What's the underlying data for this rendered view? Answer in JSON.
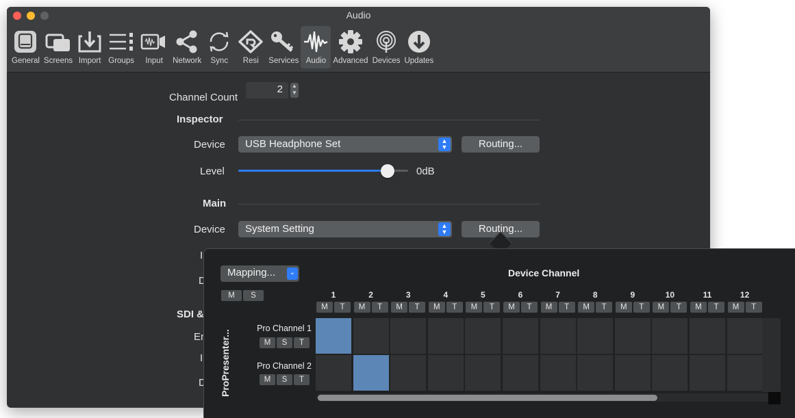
{
  "window": {
    "title": "Audio"
  },
  "toolbar": {
    "items": [
      {
        "label": "General",
        "icon": "general-icon"
      },
      {
        "label": "Screens",
        "icon": "screens-icon"
      },
      {
        "label": "Import",
        "icon": "import-icon"
      },
      {
        "label": "Groups",
        "icon": "groups-icon"
      },
      {
        "label": "Input",
        "icon": "input-icon"
      },
      {
        "label": "Network",
        "icon": "network-icon"
      },
      {
        "label": "Sync",
        "icon": "sync-icon"
      },
      {
        "label": "Resi",
        "icon": "resi-icon"
      },
      {
        "label": "Services",
        "icon": "key-icon"
      },
      {
        "label": "Audio",
        "icon": "waveform-icon",
        "active": true
      },
      {
        "label": "Advanced",
        "icon": "gear-icon"
      },
      {
        "label": "Devices",
        "icon": "devices-icon"
      },
      {
        "label": "Updates",
        "icon": "download-icon"
      }
    ]
  },
  "settings": {
    "channel_count_label": "Channel Count",
    "channel_count_value": "2",
    "inspector": {
      "title": "Inspector",
      "device_label": "Device",
      "device_value": "USB Headphone Set",
      "routing_label": "Routing...",
      "level_label": "Level",
      "level_value": "0dB",
      "level_fraction": 0.88
    },
    "main": {
      "title": "Main",
      "device_label": "Device",
      "device_value": "System Setting",
      "routing_label": "Routing..."
    },
    "hidden_labels": {
      "sdi": "SDI &",
      "en": "En",
      "d1": "D",
      "l1": "I",
      "d2": "D",
      "l2": "I"
    }
  },
  "routing_popover": {
    "mapping_label": "Mapping...",
    "ms_buttons": [
      "M",
      "S"
    ],
    "device_channel_title": "Device Channel",
    "columns": [
      "1",
      "2",
      "3",
      "4",
      "5",
      "6",
      "7",
      "8",
      "9",
      "10",
      "11",
      "12"
    ],
    "column_buttons": [
      "M",
      "T"
    ],
    "row_group_label": "ProPresenter...",
    "rows": [
      {
        "label": "Pro Channel 1",
        "buttons": [
          "M",
          "S",
          "T"
        ],
        "mapped_column": 1
      },
      {
        "label": "Pro Channel 2",
        "buttons": [
          "M",
          "S",
          "T"
        ],
        "mapped_column": 2
      }
    ]
  },
  "colors": {
    "accent": "#2f7cf6",
    "mapped_cell": "#5c86b6",
    "window_bg": "#2f3133",
    "popover_bg": "#202122"
  }
}
